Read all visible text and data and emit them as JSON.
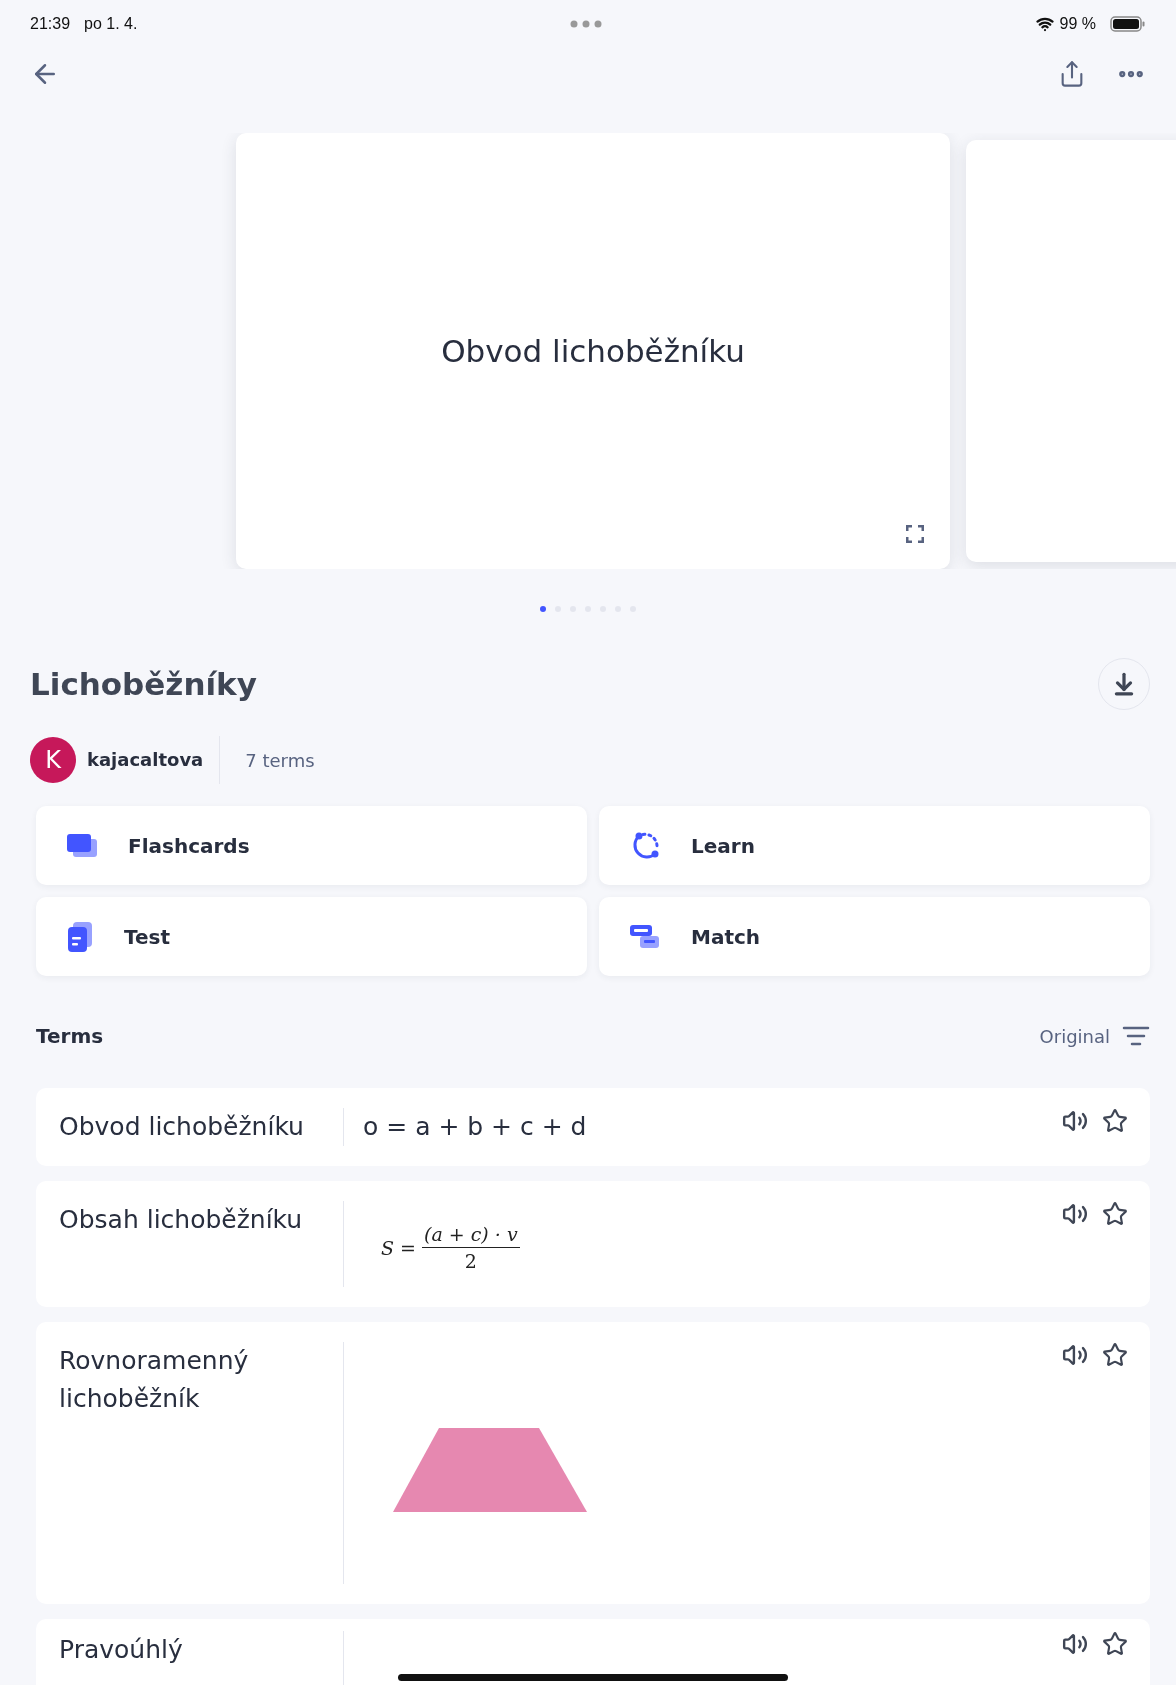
{
  "status_bar": {
    "time": "21:39",
    "date": "po 1. 4.",
    "battery": "99 %"
  },
  "carousel": {
    "card_text": "Obvod lichoběžníku",
    "pages": [
      {
        "selected": true
      },
      {
        "selected": false
      },
      {
        "selected": false
      },
      {
        "selected": false
      },
      {
        "selected": false
      },
      {
        "selected": false
      },
      {
        "selected": false
      }
    ]
  },
  "set": {
    "title": "Lichoběžníky",
    "author_initial": "K",
    "author": "kajacaltova",
    "term_count": "7 terms"
  },
  "modes": [
    {
      "kind": "flashcards",
      "label": "Flashcards"
    },
    {
      "kind": "learn",
      "label": "Learn"
    },
    {
      "kind": "test",
      "label": "Test"
    },
    {
      "kind": "match",
      "label": "Match"
    }
  ],
  "terms_header": {
    "title": "Terms",
    "sort": "Original"
  },
  "terms": [
    {
      "term": "Obvod lichoběžníku",
      "definition": {
        "kind": "text",
        "text": "o = a + b + c + d"
      },
      "starred": false
    },
    {
      "term": "Obsah lichoběžníku",
      "definition": {
        "kind": "formula",
        "lhs": "S =",
        "numerator": "(a + c) · v",
        "denominator": "2"
      },
      "starred": false
    },
    {
      "term": "Rovnoramenný lichoběžník",
      "definition": {
        "kind": "trapezoid"
      },
      "starred": false
    },
    {
      "term": "Pravoúhlý",
      "definition": {
        "kind": "hidden"
      },
      "starred": false
    }
  ]
}
